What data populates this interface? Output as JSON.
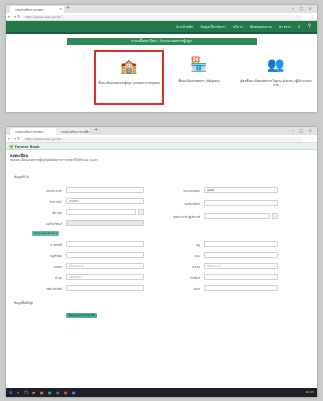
{
  "browser": {
    "tab1_title": "กรมส่งเสริมการเกษตร",
    "tab2_title": "กรมส่งเสริมการเกษตร",
    "url1": "https://www.doae.go.th/...",
    "url2": "https://www.doae.go.th/..."
  },
  "portal": {
    "nav": [
      {
        "label": "หน้าหลัก",
        "icon": "home-icon"
      },
      {
        "label": "ข้อมูลเกี่ยวกับเรา"
      },
      {
        "label": "บริการ"
      },
      {
        "label": "ติดต่อสอบถาม"
      },
      {
        "label": "ข่าวสาร"
      },
      {
        "label": "ค้นหา",
        "icon": "search-icon"
      },
      {
        "label": "เข้าสู่ระบบ",
        "icon": "login-icon"
      }
    ],
    "banner": "ระบบขึ้นทะเบียน / รับรองเกษตรกรผู้ปลูก",
    "cards": [
      {
        "label": "ขึ้นทะเบียนเกษตรกรผู้ปลูก (เกษตรกรรายบุคคล)",
        "icon": "school-building-icon",
        "selected": true
      },
      {
        "label": "ขึ้นทะเบียนเกษตรกร (นิติบุคคล)",
        "icon": "shop-icon",
        "selected": false
      },
      {
        "label": "ผู้ขอขึ้นทะเบียนเกษตรกรในฐานะตัวแทน / ผู้มีอำนาจลงนาม",
        "icon": "people-icon",
        "selected": false
      }
    ]
  },
  "form_page": {
    "app_name": "Farmer Book",
    "title": "ลงทะเบียน",
    "subtitle": "ขอลงทะเบียนเกษตรกรผู้ปลูกผลผลิตทางการเกษตรที่ได้รับรอง (GAP)",
    "section_label": "ข้อมูลทั่วไป",
    "fields_left": [
      {
        "label": "เลขประจำตัว",
        "value": ""
      },
      {
        "label": "คำนำหน้า",
        "value": "นางสาว"
      },
      {
        "label": "ชื่อ-สกุล",
        "value": ""
      },
      {
        "label": "เบอร์โทรศัพท์",
        "value": ""
      }
    ],
    "fields_right": [
      {
        "label": "ประเภทบุคคล",
        "value": "บุคคล"
      },
      {
        "label": "วันเดือนปีเกิด",
        "value": ""
      },
      {
        "label": "เลขประจำตัวผู้เสียภาษี",
        "value": ""
      }
    ],
    "address_chip": "ที่อยู่ตามทะเบียนบ้าน",
    "address_left": [
      {
        "label": "บ้านเลขที่",
        "value": ""
      },
      {
        "label": "หมู่ที่/ซอย",
        "value": ""
      },
      {
        "label": "จังหวัด",
        "value": "เลือกจังหวัด"
      },
      {
        "label": "ตำบล",
        "value": "เลือกตำบล"
      },
      {
        "label": "รหัสไปรษณีย์",
        "value": ""
      }
    ],
    "address_right": [
      {
        "label": "หมู่",
        "value": ""
      },
      {
        "label": "ถนน",
        "value": ""
      },
      {
        "label": "อำเภอ",
        "value": "เลือกอำเภอ"
      },
      {
        "label": "โทรศัพท์",
        "value": ""
      },
      {
        "label": "อีเมล",
        "value": ""
      }
    ],
    "bottom_label": "ข้อมูลพื้นที่ปลูก",
    "bottom_chip": "เพิ่มข้อมูลแปลงที่ปลูกพืช"
  },
  "taskbar": {
    "clock": "10:25"
  }
}
